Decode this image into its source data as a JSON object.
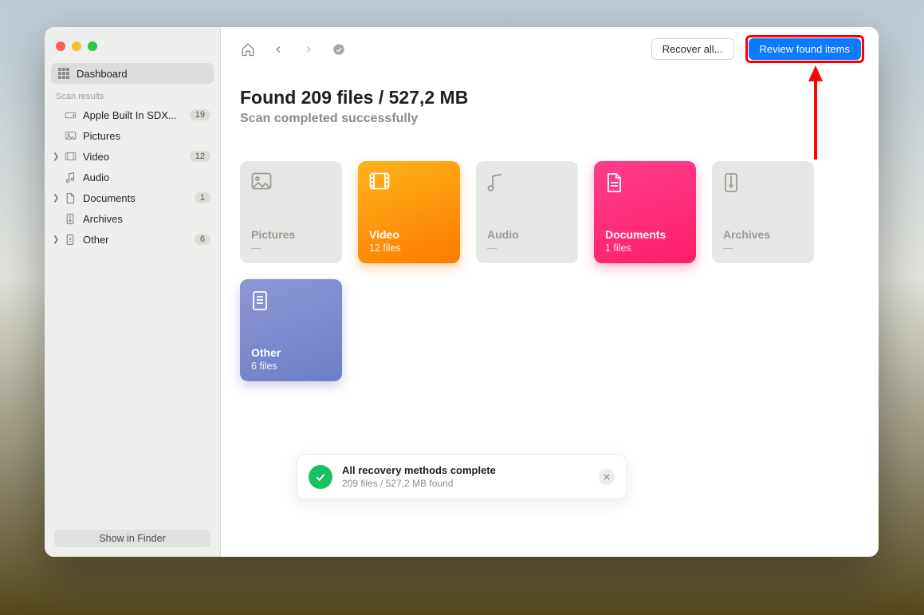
{
  "sidebar": {
    "dashboard_label": "Dashboard",
    "section_label": "Scan results",
    "items": [
      {
        "label": "Apple Built In SDX...",
        "count": "19",
        "icon": "disk",
        "expandable": false
      },
      {
        "label": "Pictures",
        "count": "",
        "icon": "picture",
        "expandable": false
      },
      {
        "label": "Video",
        "count": "12",
        "icon": "video",
        "expandable": true
      },
      {
        "label": "Audio",
        "count": "",
        "icon": "audio",
        "expandable": false
      },
      {
        "label": "Documents",
        "count": "1",
        "icon": "document",
        "expandable": true
      },
      {
        "label": "Archives",
        "count": "",
        "icon": "archive",
        "expandable": false
      },
      {
        "label": "Other",
        "count": "6",
        "icon": "other",
        "expandable": true
      }
    ],
    "footer_button": "Show in Finder"
  },
  "toolbar": {
    "recover_label": "Recover all...",
    "review_label": "Review found items"
  },
  "header": {
    "title": "Found 209 files / 527,2 MB",
    "subtitle": "Scan completed successfully"
  },
  "cards": [
    {
      "kind": "pictures",
      "title": "Pictures",
      "sub": "—",
      "style": "muted"
    },
    {
      "kind": "video",
      "title": "Video",
      "sub": "12 files",
      "style": "video"
    },
    {
      "kind": "audio",
      "title": "Audio",
      "sub": "—",
      "style": "muted"
    },
    {
      "kind": "documents",
      "title": "Documents",
      "sub": "1 files",
      "style": "documents"
    },
    {
      "kind": "archives",
      "title": "Archives",
      "sub": "—",
      "style": "muted"
    },
    {
      "kind": "other",
      "title": "Other",
      "sub": "6 files",
      "style": "other"
    }
  ],
  "toast": {
    "title": "All recovery methods complete",
    "subtitle": "209 files / 527,2 MB found"
  },
  "colors": {
    "primary": "#0a7aff",
    "annotation": "#ff0000"
  }
}
